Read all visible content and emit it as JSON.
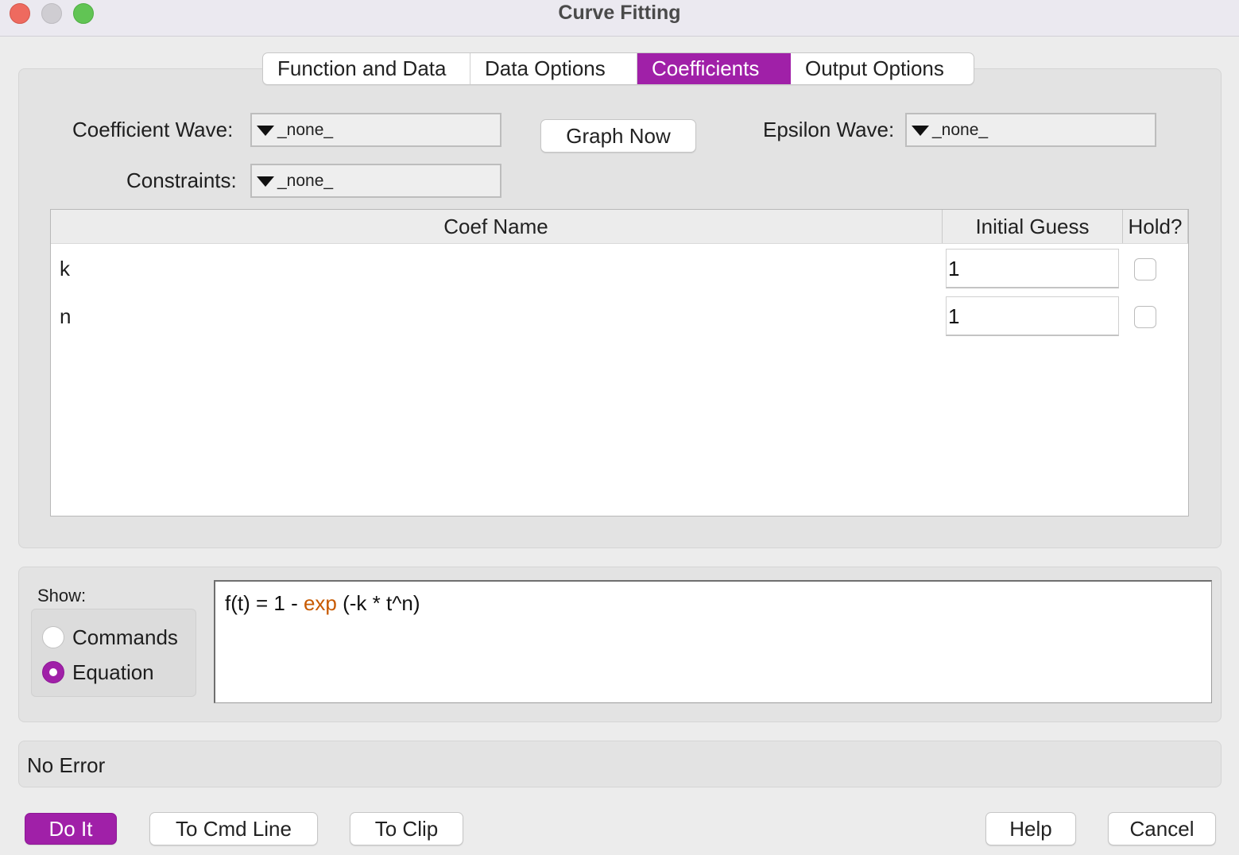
{
  "window": {
    "title": "Curve Fitting"
  },
  "tabs": [
    {
      "label": "Function and Data",
      "active": false
    },
    {
      "label": "Data Options",
      "active": false
    },
    {
      "label": "Coefficients",
      "active": true
    },
    {
      "label": "Output Options",
      "active": false
    }
  ],
  "coefficients": {
    "coef_wave_label": "Coefficient Wave:",
    "coef_wave_value": "_none_",
    "constraints_label": "Constraints:",
    "constraints_value": "_none_",
    "graph_now_label": "Graph Now",
    "epsilon_wave_label": "Epsilon Wave:",
    "epsilon_wave_value": "_none_"
  },
  "table": {
    "headers": [
      "Coef Name",
      "Initial Guess",
      "Hold?"
    ],
    "rows": [
      {
        "name": "k",
        "guess": "1",
        "hold": false
      },
      {
        "name": "n",
        "guess": "1",
        "hold": false
      }
    ]
  },
  "show": {
    "label": "Show:",
    "options": [
      {
        "label": "Commands",
        "selected": false
      },
      {
        "label": "Equation",
        "selected": true
      }
    ],
    "equation_before": "f(t) = 1 - ",
    "equation_keyword": "exp",
    "equation_after": " (-k * t^n)"
  },
  "status": {
    "text": "No Error"
  },
  "buttons": {
    "do_it": "Do It",
    "to_cmd_line": "To Cmd Line",
    "to_clip": "To Clip",
    "help": "Help",
    "cancel": "Cancel"
  },
  "colors": {
    "accent": "#a020a8",
    "keyword": "#c85a00"
  }
}
